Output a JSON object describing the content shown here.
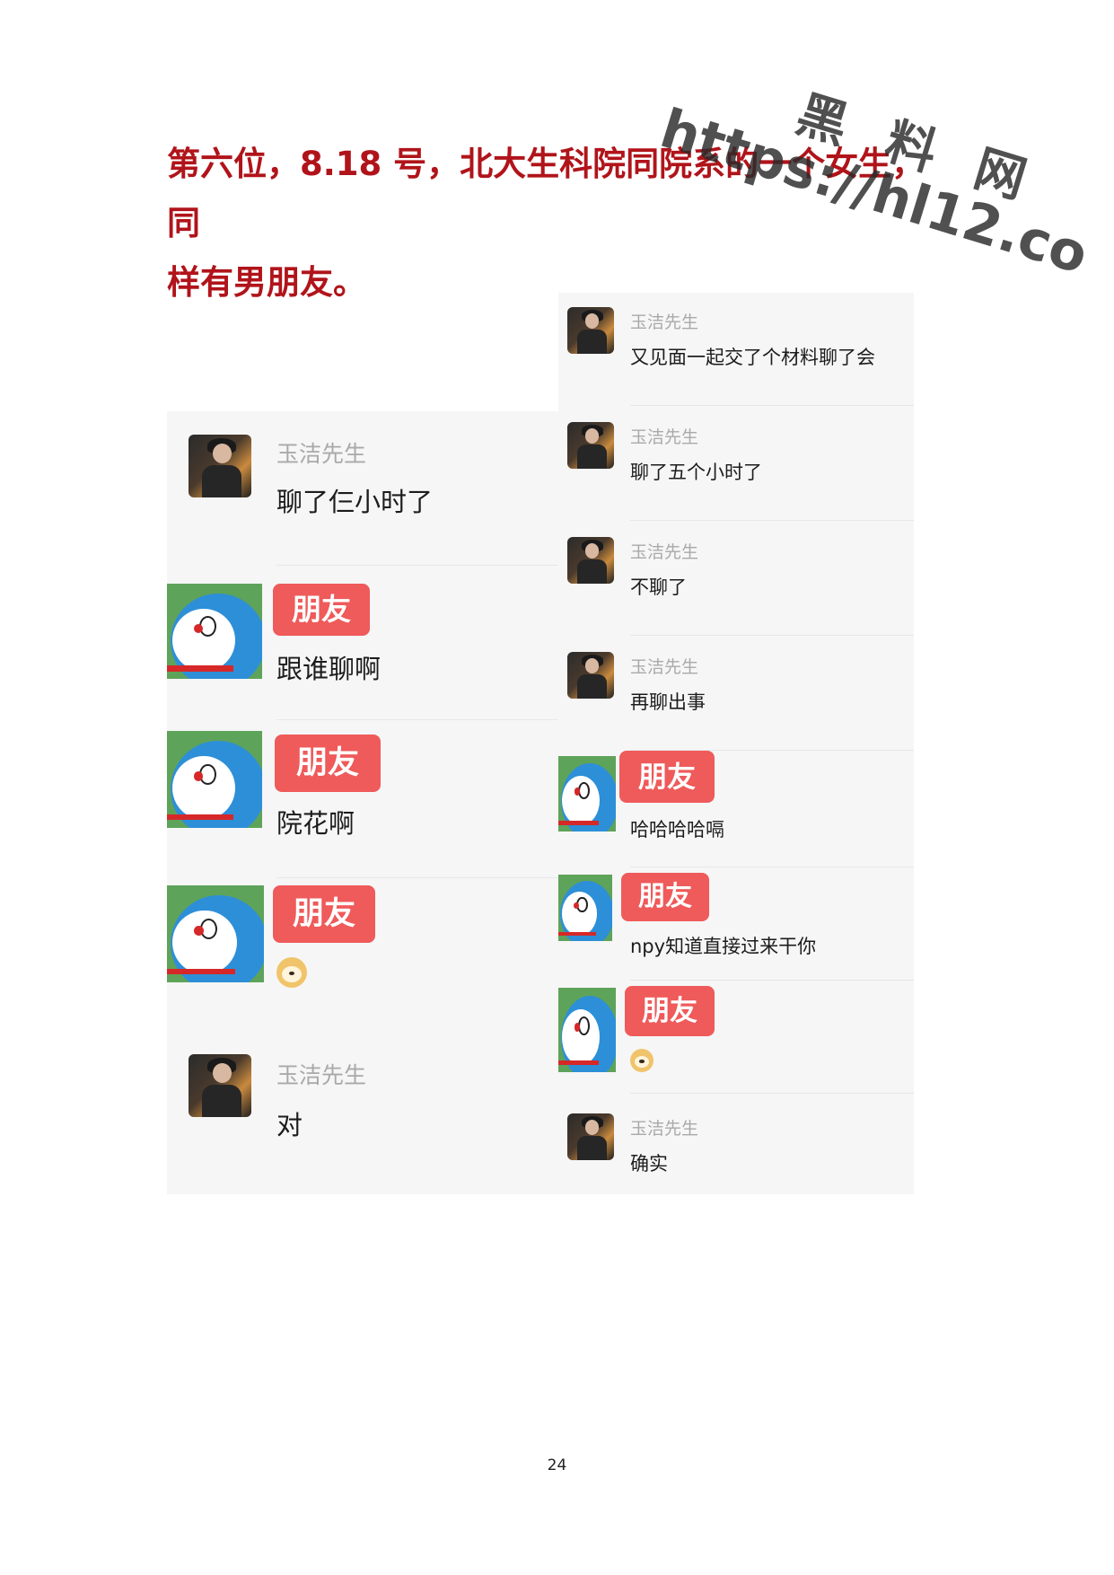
{
  "heading": {
    "line1": "第六位，8.18 号，北大生科院同院系的一个女生，同",
    "line2": "样有男朋友。"
  },
  "watermark": {
    "site_name": "黑 料 网",
    "url": "https://hl12.co"
  },
  "left_chat": [
    {
      "sender": "玉洁先生",
      "text": "聊了仨小时了",
      "avatar": "photo-avatar"
    },
    {
      "sender": "朋友",
      "text": "跟谁聊啊",
      "avatar": "doraemon-avatar"
    },
    {
      "sender": "朋友",
      "text": "院花啊",
      "avatar": "doraemon-avatar"
    },
    {
      "sender": "朋友",
      "text": "",
      "emoji": "doge-emoji",
      "avatar": "doraemon-avatar"
    },
    {
      "sender": "玉洁先生",
      "text": "对",
      "avatar": "photo-avatar"
    }
  ],
  "right_chat": [
    {
      "sender": "玉洁先生",
      "text": "又见面一起交了个材料聊了会",
      "avatar": "photo-avatar"
    },
    {
      "sender": "玉洁先生",
      "text": "聊了五个小时了",
      "avatar": "photo-avatar"
    },
    {
      "sender": "玉洁先生",
      "text": "不聊了",
      "avatar": "photo-avatar"
    },
    {
      "sender": "玉洁先生",
      "text": "再聊出事",
      "avatar": "photo-avatar"
    },
    {
      "sender": "朋友",
      "text": "哈哈哈哈嗝",
      "avatar": "doraemon-avatar"
    },
    {
      "sender": "朋友",
      "text": "npy知道直接过来干你",
      "avatar": "doraemon-avatar"
    },
    {
      "sender": "朋友",
      "text": "",
      "emoji": "doge-emoji",
      "avatar": "doraemon-avatar"
    },
    {
      "sender": "玉洁先生",
      "text": "确实",
      "avatar": "photo-avatar"
    }
  ],
  "page_number": "24",
  "colors": {
    "heading": "#b0141a",
    "badge": "#ef5a5a",
    "panel_background": "#f6f6f6",
    "sender_name": "#a9a9a9"
  }
}
